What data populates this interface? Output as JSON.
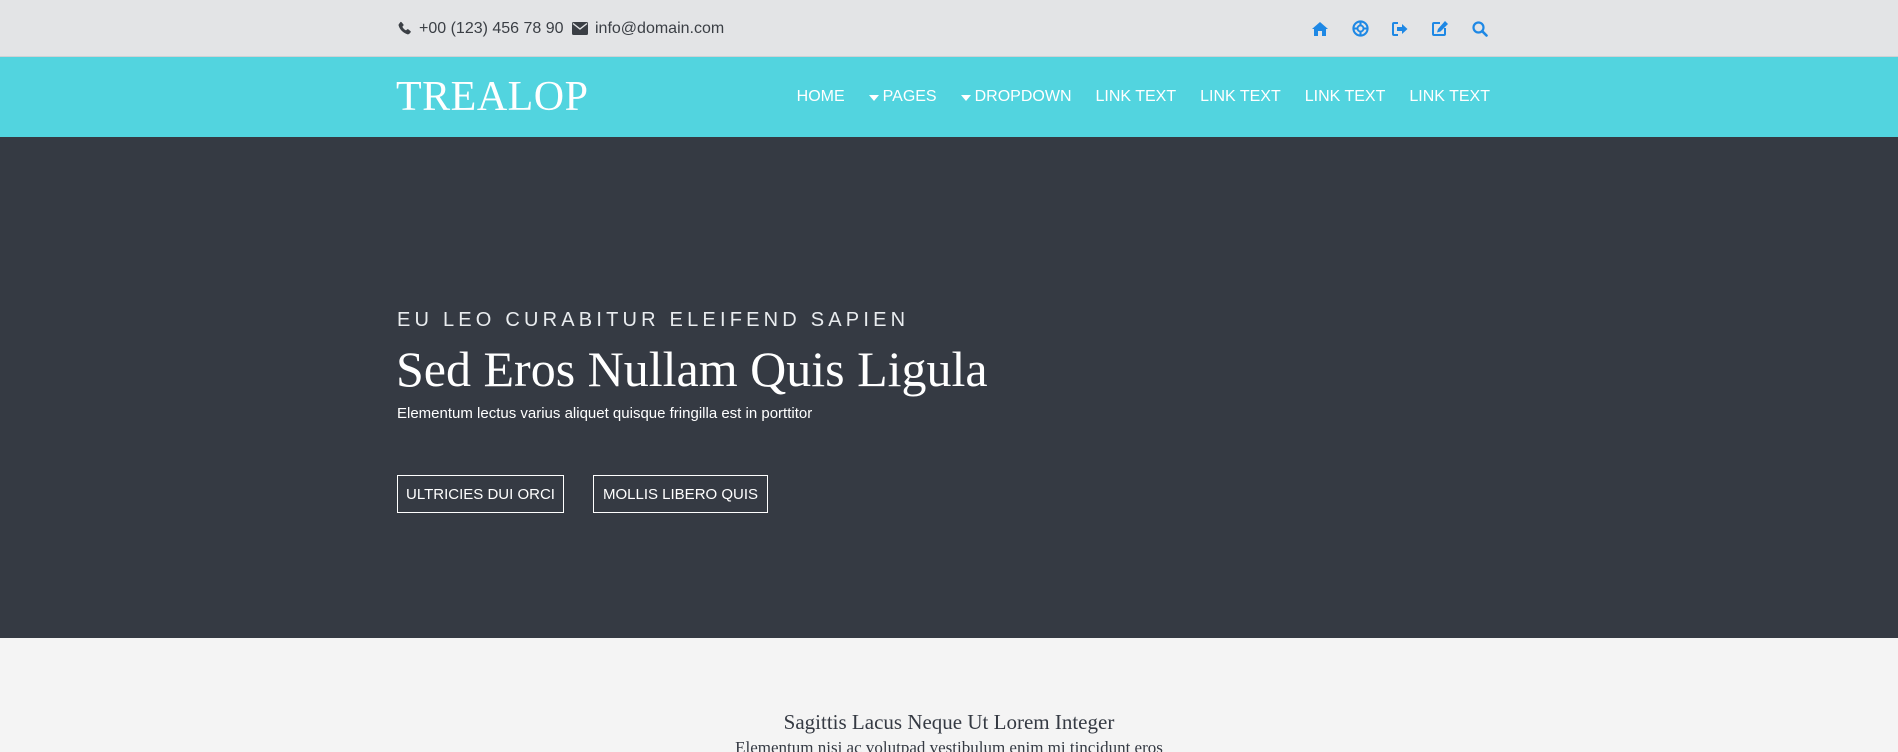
{
  "topbar": {
    "phone": "+00 (123) 456 78 90",
    "email": "info@domain.com",
    "icons": [
      "home-icon",
      "lifebuoy-icon",
      "sign-out-icon",
      "edit-icon",
      "search-icon"
    ],
    "icon_color": "#1e88e5"
  },
  "navbar": {
    "brand": "TREALOP",
    "background": "#52d4df",
    "items": [
      {
        "label": "HOME",
        "dropdown": false
      },
      {
        "label": "PAGES",
        "dropdown": true
      },
      {
        "label": "DROPDOWN",
        "dropdown": true
      },
      {
        "label": "LINK TEXT",
        "dropdown": false
      },
      {
        "label": "LINK TEXT",
        "dropdown": false
      },
      {
        "label": "LINK TEXT",
        "dropdown": false
      },
      {
        "label": "LINK TEXT",
        "dropdown": false
      }
    ]
  },
  "hero": {
    "background": "#353a43",
    "eyebrow": "EU LEO CURABITUR ELEIFEND SAPIEN",
    "title": "Sed Eros Nullam Quis Ligula",
    "subtitle": "Elementum lectus varius aliquet quisque fringilla est in porttitor",
    "buttons": [
      {
        "label": "ULTRICIES DUI ORCI"
      },
      {
        "label": "MOLLIS LIBERO QUIS"
      }
    ]
  },
  "section": {
    "title": "Sagittis Lacus Neque Ut Lorem Integer",
    "subtitle": "Elementum nisi ac volutpad vestibulum enim mi tincidunt eros"
  }
}
